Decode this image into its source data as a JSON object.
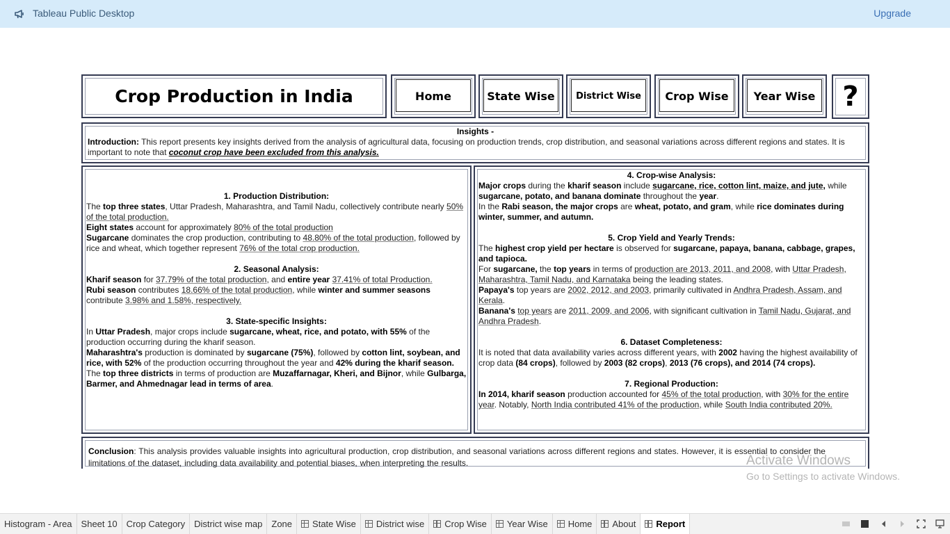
{
  "app": {
    "title": "Tableau Public Desktop",
    "upgrade_label": "Upgrade"
  },
  "header": {
    "title": "Crop Production in India",
    "nav": [
      {
        "label": "Home"
      },
      {
        "label": "State Wise"
      },
      {
        "label": "District Wise"
      },
      {
        "label": "Crop Wise"
      },
      {
        "label": "Year Wise"
      }
    ],
    "help": "?"
  },
  "insights": {
    "heading": "Insights -",
    "intro_label": "Introduction:",
    "intro_text": " This report presents key insights derived from the analysis of agricultural data, focusing on production trends, crop distribution, and seasonal variations across different regions and states. It is important to note that ",
    "intro_emphasis": "coconut crop have been excluded from this analysis."
  },
  "sections": {
    "s1": {
      "heading": "1. Production Distribution:",
      "p1a": "The ",
      "p1b": "top three states",
      "p1c": ", Uttar Pradesh, Maharashtra, and Tamil Nadu, collectively contribute nearly ",
      "p1d": "50% of the total production.",
      "p2a": "Eight states",
      "p2b": " account for approximately ",
      "p2c": "80% of the total production",
      "p3a": "Sugarcane",
      "p3b": " dominates the crop production, contributing to ",
      "p3c": "48.80% of the total production",
      "p3d": ", followed by rice and wheat, which together represent ",
      "p3e": "76% of the total crop production."
    },
    "s2": {
      "heading": "2. Seasonal Analysis:",
      "p1a": "Kharif season",
      "p1b": " for ",
      "p1c": "37.79% of the total production",
      "p1d": ", and ",
      "p1e": "entire year",
      "p1f": "37.41% of total Production.",
      "p2a": "Rubi season",
      "p2b": " contributes ",
      "p2c": "18.66% of the total production",
      "p2d": ", while ",
      "p2e": "winter and summer seasons",
      "p2f": " contribute ",
      "p2g": "3.98% and 1.58%, respectively."
    },
    "s3": {
      "heading": "3. State-specific Insights:",
      "p1a": "In ",
      "p1b": "Uttar Pradesh",
      "p1c": ", major crops include ",
      "p1d": "sugarcane, wheat, rice, and potato, with 55%",
      "p1e": " of the production occurring during the kharif season.",
      "p2a": "Maharashtra's",
      "p2b": " production is dominated by ",
      "p2c": "sugarcane (75%)",
      "p2d": ", followed by ",
      "p2e": "cotton lint, soybean, and rice, with 52%",
      "p2f": " of the production occurring throughout the year and ",
      "p2g": "42% during the kharif season.",
      "p3a": "The ",
      "p3b": "top three districts",
      "p3c": " in terms of production are ",
      "p3d": "Muzaffarnagar, Kheri, and Bijnor",
      "p3e": ", while ",
      "p3f": "Gulbarga, Barmer, and Ahmednagar lead in terms of area",
      "p3g": "."
    },
    "s4": {
      "heading": "4. Crop-wise Analysis:",
      "p1a": "Major crops",
      "p1b": " during the ",
      "p1c": "kharif season",
      "p1d": " include ",
      "p1e": "sugarcane, rice, cotton lint, maize, and jute,",
      "p1f": " while ",
      "p1g": "sugarcane, potato, and banana dominate",
      "p1h": " throughout the ",
      "p1i": "year",
      "p1j": ".",
      "p2a": "In the ",
      "p2b": "Rabi season, the major crops",
      "p2c": " are ",
      "p2d": "wheat, potato, and gram",
      "p2e": ", while ",
      "p2f": "rice dominates during winter, summer, and autumn."
    },
    "s5": {
      "heading": "5. Crop Yield and Yearly Trends:",
      "p1a": "The ",
      "p1b": "highest crop yield per hectare",
      "p1c": " is observed for ",
      "p1d": "sugarcane, papaya, banana, cabbage, grapes, and tapioca.",
      "p2a": "For ",
      "p2b": "sugarcane,",
      "p2c": " the ",
      "p2d": "top years",
      "p2e": " in terms of ",
      "p2f": "production are 2013, 2011, and 2008",
      "p2g": ", with ",
      "p2h": "Uttar Pradesh, Maharashtra, Tamil Nadu, and Karnataka",
      "p2i": " being the leading states.",
      "p3a": "Papaya's",
      "p3b": " top years are ",
      "p3c": "2002, 2012, and 2003",
      "p3d": ", primarily cultivated in ",
      "p3e": "Andhra Pradesh, Assam, and Kerala",
      "p4a": "Banana's",
      "p4b": "top years",
      "p4c": " are ",
      "p4d": "2011, 2009, and 2006",
      "p4e": ", with significant cultivation in ",
      "p4f": "Tamil Nadu, Gujarat, and Andhra Pradesh"
    },
    "s6": {
      "heading": "6. Dataset Completeness:",
      "p1a": "It is noted that data availability varies across different years, with ",
      "p1b": "2002",
      "p1c": " having the highest availability of crop data ",
      "p1d": "(84 crops)",
      "p1e": ", followed by ",
      "p1f": "2003 (82 crops)",
      "p1g": ", ",
      "p1h": "2013 (76 crops), and 2014 (74 crops)."
    },
    "s7": {
      "heading": "7. Regional Production:",
      "p1a": "In 2014, kharif season",
      "p1b": " production accounted for ",
      "p1c": "45% of the total production",
      "p1d": ", with ",
      "p1e": "30% for the entire year",
      "p1f": ". Notably, ",
      "p1g": "North India contributed 41% of the production",
      "p1h": ", while ",
      "p1i": "South India contributed 20%."
    }
  },
  "conclusion": {
    "label": "Conclusion",
    "text": ": This analysis provides valuable insights into agricultural production, crop distribution, and seasonal variations across different regions and states. However, it is essential to consider the limitations of the dataset, including data availability and potential biases, when interpreting the results."
  },
  "watermark": {
    "line1": "Activate Windows",
    "line2": "Go to Settings to activate Windows."
  },
  "tabs": [
    {
      "label": "Histogram - Area"
    },
    {
      "label": "Sheet 10"
    },
    {
      "label": "Crop Category"
    },
    {
      "label": "District wise map"
    },
    {
      "label": "Zone"
    },
    {
      "label": "State Wise"
    },
    {
      "label": "District wise"
    },
    {
      "label": "Crop Wise"
    },
    {
      "label": "Year Wise"
    },
    {
      "label": "Home"
    },
    {
      "label": "About"
    },
    {
      "label": "Report"
    }
  ]
}
